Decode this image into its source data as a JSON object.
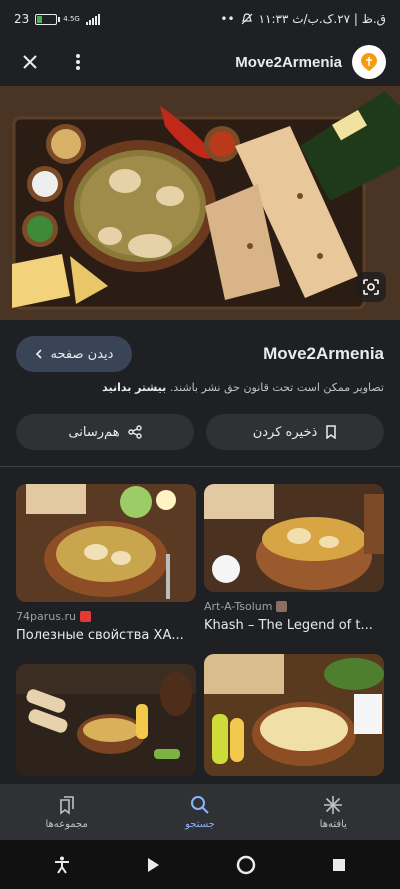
{
  "status": {
    "battery_text": "23",
    "network": "4.5G",
    "time_text": "۱۱:۳۳ ق.ظ | ۲۷.ک.ب/ث"
  },
  "appbar": {
    "title": "Move2Armenia"
  },
  "info": {
    "visit_label": "دیدن صفحه",
    "site_title": "Move2Armenia",
    "copyright": "تصاویر ممکن است تحت قانون حق نشر باشند.",
    "learn_more": "بیشتر بدانید",
    "share_label": "هم‌رسانی",
    "save_label": "ذخیره کردن"
  },
  "results": [
    {
      "source": "74parus.ru",
      "title": "Полезные свойства ХА...",
      "fav_color": "#e53935"
    },
    {
      "source": "Art-A-Tsolum",
      "title": "Khash – The Legend of t...",
      "fav_color": "#8d6e63"
    }
  ],
  "bottom_nav": [
    {
      "label": "یافته‌ها",
      "icon": "sparkle-icon"
    },
    {
      "label": "جستجو",
      "icon": "search-icon"
    },
    {
      "label": "مجموعه‌ها",
      "icon": "collections-icon"
    }
  ]
}
